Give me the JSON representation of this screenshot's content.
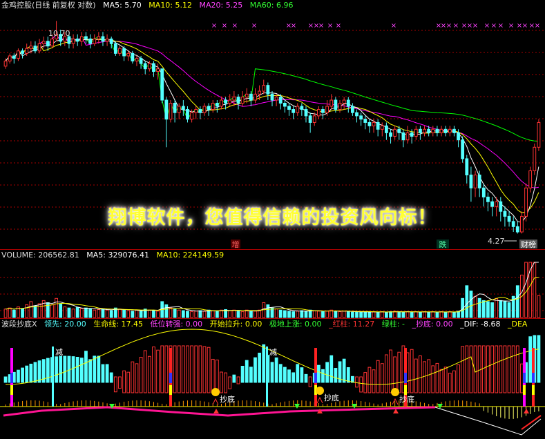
{
  "main_header": {
    "title": "金鸡控股(日线 前复权 对数)",
    "ma5": "MA5: 5.70",
    "ma10": "MA10: 5.12",
    "ma20": "MA20: 5.25",
    "ma60": "MA60: 6.96"
  },
  "main_labels": {
    "high": "10.70",
    "low": "4.27",
    "zeng": "增",
    "die": "跌",
    "caibang": "财榜"
  },
  "banner": "翔博软件，您值得信赖的投资风向标！",
  "volume_header": {
    "volume": "VOLUME: 206562.81",
    "ma5": "MA5: 329076.41",
    "ma10": "MA10: 224149.59"
  },
  "ind_header": {
    "name": "波段抄底X",
    "lingxian": "领先: 20.00",
    "shengming": "生命线: 17.45",
    "diwei": "低位转强: 0.00",
    "kaishi": "开始拉升: 0.00",
    "jidi": "极地上涨: 0.00",
    "hongzhu": "_红柱: 11.27",
    "lvzhu": "绿柱: -",
    "chaodi": "_抄底: 0.00",
    "dif": "_DIF: -8.68",
    "dea": "_DEA"
  },
  "ind_labels": {
    "jian": "减",
    "chaodi": "抄底"
  },
  "colors": {
    "up": "#ff3333",
    "down": "#54ffff",
    "ma5": "#ffffff",
    "ma10": "#ffff00",
    "ma20": "#ff00ff",
    "ma60": "#00ff00",
    "grid": "#aa0000"
  },
  "chart_data": {
    "type": "candlestick",
    "price_range": [
      4.27,
      10.7
    ],
    "candles": [
      [
        8.8,
        9.0,
        8.7,
        9.1
      ],
      [
        9.0,
        9.2,
        8.9,
        9.3
      ],
      [
        9.2,
        9.1,
        8.9,
        9.3
      ],
      [
        9.1,
        9.4,
        9.0,
        9.5
      ],
      [
        9.4,
        9.3,
        9.1,
        9.5
      ],
      [
        9.3,
        9.5,
        9.2,
        9.7
      ],
      [
        9.5,
        9.6,
        9.3,
        9.8
      ],
      [
        9.6,
        9.4,
        9.3,
        9.8
      ],
      [
        9.4,
        9.7,
        9.3,
        9.9
      ],
      [
        9.7,
        9.8,
        9.5,
        10.0
      ],
      [
        9.8,
        9.6,
        9.4,
        10.0
      ],
      [
        9.6,
        9.9,
        9.5,
        10.1
      ],
      [
        9.9,
        10.1,
        9.8,
        10.7
      ],
      [
        10.1,
        9.8,
        9.6,
        10.3
      ],
      [
        9.8,
        10.0,
        9.6,
        10.2
      ],
      [
        10.0,
        9.7,
        9.5,
        10.1
      ],
      [
        9.7,
        9.9,
        9.5,
        10.1
      ],
      [
        9.9,
        9.8,
        9.6,
        10.1
      ],
      [
        9.8,
        10.0,
        9.6,
        10.2
      ],
      [
        10.0,
        9.9,
        9.7,
        10.2
      ],
      [
        9.9,
        9.7,
        9.5,
        10.1
      ],
      [
        9.7,
        9.9,
        9.6,
        10.1
      ],
      [
        9.9,
        10.0,
        9.7,
        10.2
      ],
      [
        10.0,
        9.8,
        9.6,
        10.2
      ],
      [
        9.8,
        9.9,
        9.6,
        10.1
      ],
      [
        9.9,
        9.7,
        9.5,
        10.0
      ],
      [
        9.7,
        9.3,
        9.2,
        9.8
      ],
      [
        9.3,
        9.5,
        9.2,
        9.6
      ],
      [
        9.5,
        9.2,
        9.0,
        9.6
      ],
      [
        9.2,
        9.3,
        9.0,
        9.4
      ],
      [
        9.3,
        9.0,
        8.9,
        9.4
      ],
      [
        9.0,
        9.1,
        8.8,
        9.2
      ],
      [
        9.1,
        8.9,
        8.7,
        9.2
      ],
      [
        8.9,
        8.7,
        8.5,
        9.0
      ],
      [
        8.7,
        8.9,
        8.6,
        9.0
      ],
      [
        8.9,
        8.6,
        8.4,
        9.0
      ],
      [
        8.6,
        8.7,
        8.3,
        8.9
      ],
      [
        8.7,
        7.6,
        7.5,
        8.7
      ],
      [
        7.6,
        7.0,
        6.2,
        7.7
      ],
      [
        7.0,
        7.5,
        6.9,
        7.6
      ],
      [
        7.5,
        7.2,
        6.9,
        7.6
      ],
      [
        7.2,
        7.4,
        7.0,
        7.5
      ],
      [
        7.4,
        7.3,
        7.1,
        7.6
      ],
      [
        7.3,
        7.0,
        6.9,
        7.4
      ],
      [
        7.0,
        7.2,
        6.9,
        7.3
      ],
      [
        7.2,
        7.3,
        7.0,
        7.4
      ],
      [
        7.3,
        7.2,
        7.0,
        7.4
      ],
      [
        7.2,
        7.4,
        7.1,
        7.5
      ],
      [
        7.4,
        7.3,
        7.1,
        7.5
      ],
      [
        7.3,
        7.5,
        7.2,
        7.6
      ],
      [
        7.5,
        7.4,
        7.2,
        7.6
      ],
      [
        7.4,
        7.6,
        7.3,
        7.7
      ],
      [
        7.6,
        7.5,
        7.3,
        7.7
      ],
      [
        7.5,
        7.6,
        7.4,
        7.8
      ],
      [
        7.6,
        7.7,
        7.4,
        7.9
      ],
      [
        7.7,
        7.5,
        7.3,
        7.8
      ],
      [
        7.5,
        7.7,
        7.4,
        7.9
      ],
      [
        7.7,
        7.8,
        7.5,
        8.0
      ],
      [
        7.8,
        7.6,
        7.4,
        7.9
      ],
      [
        7.6,
        7.8,
        7.5,
        8.0
      ],
      [
        7.8,
        7.9,
        7.6,
        8.1
      ],
      [
        7.9,
        8.1,
        7.8,
        8.3
      ],
      [
        8.1,
        7.8,
        7.6,
        8.2
      ],
      [
        7.8,
        7.6,
        7.4,
        7.9
      ],
      [
        7.6,
        7.7,
        7.4,
        7.8
      ],
      [
        7.7,
        7.5,
        7.3,
        7.8
      ],
      [
        7.5,
        7.4,
        7.2,
        7.6
      ],
      [
        7.4,
        7.3,
        7.1,
        7.5
      ],
      [
        7.3,
        7.2,
        7.0,
        7.4
      ],
      [
        7.2,
        7.4,
        7.1,
        7.5
      ],
      [
        7.4,
        7.3,
        7.1,
        7.5
      ],
      [
        7.3,
        7.1,
        6.9,
        7.4
      ],
      [
        7.1,
        6.9,
        6.6,
        7.2
      ],
      [
        6.9,
        7.1,
        6.8,
        7.2
      ],
      [
        7.1,
        7.3,
        7.0,
        7.4
      ],
      [
        7.3,
        7.2,
        7.0,
        7.4
      ],
      [
        7.2,
        7.4,
        7.1,
        7.6
      ],
      [
        7.4,
        7.6,
        7.3,
        7.8
      ],
      [
        7.6,
        7.3,
        7.2,
        7.7
      ],
      [
        7.3,
        7.5,
        7.2,
        7.6
      ],
      [
        7.5,
        7.6,
        7.3,
        7.7
      ],
      [
        7.6,
        7.4,
        7.2,
        7.7
      ],
      [
        7.4,
        7.2,
        7.1,
        7.5
      ],
      [
        7.2,
        7.1,
        6.9,
        7.3
      ],
      [
        7.1,
        7.0,
        6.8,
        7.2
      ],
      [
        7.0,
        6.9,
        6.7,
        7.1
      ],
      [
        6.9,
        6.8,
        6.6,
        7.0
      ],
      [
        6.8,
        6.9,
        6.6,
        7.0
      ],
      [
        6.9,
        6.7,
        6.5,
        7.0
      ],
      [
        6.7,
        6.8,
        6.5,
        6.9
      ],
      [
        6.8,
        6.6,
        6.4,
        6.9
      ],
      [
        6.6,
        6.5,
        6.3,
        6.7
      ],
      [
        6.5,
        6.7,
        6.4,
        6.8
      ],
      [
        6.7,
        6.6,
        6.4,
        6.8
      ],
      [
        6.6,
        6.4,
        6.2,
        6.7
      ],
      [
        6.4,
        6.6,
        6.3,
        6.8
      ],
      [
        6.6,
        6.5,
        6.3,
        6.7
      ],
      [
        6.5,
        6.7,
        6.4,
        6.8
      ],
      [
        6.7,
        6.6,
        6.4,
        6.8
      ],
      [
        6.6,
        6.7,
        6.5,
        6.8
      ],
      [
        6.7,
        6.6,
        6.5,
        6.8
      ],
      [
        6.6,
        6.7,
        6.5,
        6.8
      ],
      [
        6.7,
        6.6,
        6.5,
        6.8
      ],
      [
        6.6,
        6.7,
        6.5,
        6.8
      ],
      [
        6.7,
        6.6,
        6.5,
        6.8
      ],
      [
        6.6,
        6.7,
        6.5,
        6.8
      ],
      [
        6.7,
        6.6,
        6.5,
        6.8
      ],
      [
        6.6,
        6.4,
        6.2,
        6.7
      ],
      [
        6.4,
        5.9,
        5.8,
        6.5
      ],
      [
        5.9,
        5.5,
        5.3,
        6.0
      ],
      [
        5.5,
        5.2,
        4.9,
        5.7
      ],
      [
        5.2,
        5.5,
        5.0,
        5.6
      ],
      [
        5.5,
        5.2,
        5.0,
        5.6
      ],
      [
        5.2,
        5.0,
        4.8,
        5.3
      ],
      [
        5.0,
        4.9,
        4.7,
        5.1
      ],
      [
        4.9,
        4.8,
        4.6,
        5.0
      ],
      [
        4.8,
        4.9,
        4.6,
        5.0
      ],
      [
        4.9,
        4.7,
        4.5,
        5.0
      ],
      [
        4.7,
        4.6,
        4.4,
        4.8
      ],
      [
        4.6,
        4.5,
        4.4,
        4.7
      ],
      [
        4.5,
        4.4,
        4.3,
        4.6
      ],
      [
        4.4,
        4.3,
        4.27,
        4.5
      ],
      [
        4.3,
        4.6,
        4.27,
        4.7
      ],
      [
        4.6,
        5.2,
        4.5,
        5.3
      ],
      [
        5.2,
        5.6,
        5.1,
        5.7
      ],
      [
        5.6,
        6.2,
        5.5,
        6.3
      ],
      [
        6.2,
        6.9,
        6.1,
        7.0
      ]
    ],
    "volume_range": [
      0,
      1000000
    ],
    "volumes": [
      80000,
      90000,
      70000,
      100000,
      85000,
      120000,
      150000,
      110000,
      130000,
      160000,
      140000,
      120000,
      180000,
      130000,
      100000,
      90000,
      80000,
      95000,
      85000,
      90000,
      80000,
      70000,
      75000,
      80000,
      70000,
      65000,
      90000,
      80000,
      70000,
      65000,
      60000,
      70000,
      60000,
      80000,
      70000,
      65000,
      60000,
      150000,
      120000,
      90000,
      80000,
      70000,
      65000,
      60000,
      55000,
      60000,
      65000,
      60000,
      70000,
      65000,
      60000,
      70000,
      75000,
      65000,
      70000,
      60000,
      55000,
      70000,
      65000,
      60000,
      70000,
      140000,
      120000,
      90000,
      80000,
      70000,
      65000,
      60000,
      55000,
      60000,
      65000,
      60000,
      70000,
      65000,
      60000,
      55000,
      60000,
      70000,
      60000,
      55000,
      60000,
      55000,
      50000,
      55000,
      50000,
      55000,
      50000,
      55000,
      50000,
      55000,
      50000,
      55000,
      60000,
      55000,
      50000,
      55000,
      50000,
      55000,
      50000,
      55000,
      50000,
      55000,
      50000,
      55000,
      50000,
      55000,
      50000,
      60000,
      180000,
      300000,
      250000,
      200000,
      180000,
      160000,
      150000,
      140000,
      180000,
      160000,
      150000,
      140000,
      200000,
      300000,
      400000,
      600000,
      750000,
      850000,
      206562
    ],
    "indicator_markers": [
      "减",
      "抄底"
    ]
  }
}
